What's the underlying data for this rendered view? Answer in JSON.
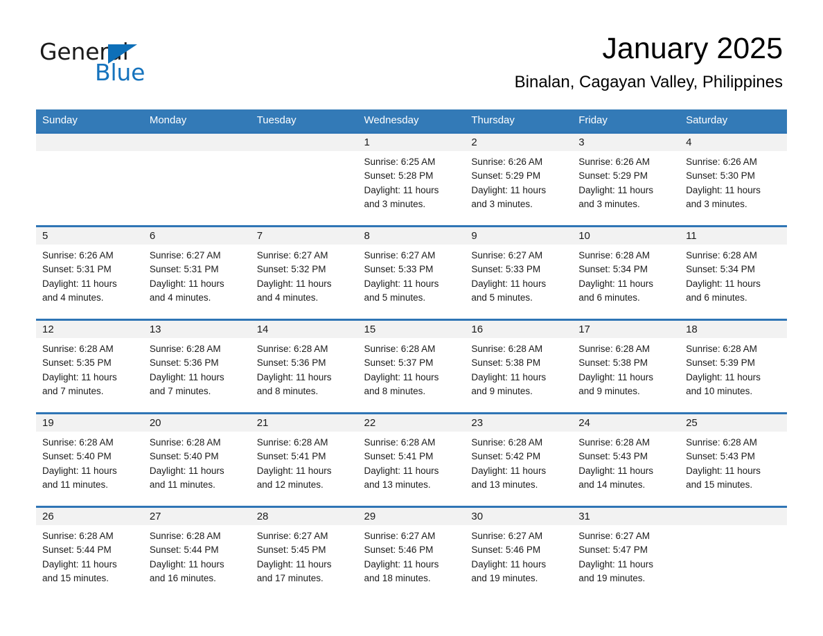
{
  "brand": {
    "name_part1": "General",
    "name_part2": "Blue",
    "triangle_color": "#0d6fb8",
    "blue_text_color": "#1673bd"
  },
  "header": {
    "title": "January 2025",
    "subtitle": "Binalan, Cagayan Valley, Philippines"
  },
  "colors": {
    "header_row_bg": "#337ab7",
    "week_border": "#2f75b5",
    "daynum_band_bg": "#f2f2f2",
    "text": "#1a1a1a"
  },
  "calendar": {
    "weekday_headers": [
      "Sunday",
      "Monday",
      "Tuesday",
      "Wednesday",
      "Thursday",
      "Friday",
      "Saturday"
    ],
    "weeks": [
      [
        {
          "day": "",
          "sunrise": "",
          "sunset": "",
          "daylight_line1": "",
          "daylight_line2": "",
          "blank": true
        },
        {
          "day": "",
          "sunrise": "",
          "sunset": "",
          "daylight_line1": "",
          "daylight_line2": "",
          "blank": true
        },
        {
          "day": "",
          "sunrise": "",
          "sunset": "",
          "daylight_line1": "",
          "daylight_line2": "",
          "blank": true
        },
        {
          "day": "1",
          "sunrise": "Sunrise: 6:25 AM",
          "sunset": "Sunset: 5:28 PM",
          "daylight_line1": "Daylight: 11 hours",
          "daylight_line2": "and 3 minutes."
        },
        {
          "day": "2",
          "sunrise": "Sunrise: 6:26 AM",
          "sunset": "Sunset: 5:29 PM",
          "daylight_line1": "Daylight: 11 hours",
          "daylight_line2": "and 3 minutes."
        },
        {
          "day": "3",
          "sunrise": "Sunrise: 6:26 AM",
          "sunset": "Sunset: 5:29 PM",
          "daylight_line1": "Daylight: 11 hours",
          "daylight_line2": "and 3 minutes."
        },
        {
          "day": "4",
          "sunrise": "Sunrise: 6:26 AM",
          "sunset": "Sunset: 5:30 PM",
          "daylight_line1": "Daylight: 11 hours",
          "daylight_line2": "and 3 minutes."
        }
      ],
      [
        {
          "day": "5",
          "sunrise": "Sunrise: 6:26 AM",
          "sunset": "Sunset: 5:31 PM",
          "daylight_line1": "Daylight: 11 hours",
          "daylight_line2": "and 4 minutes."
        },
        {
          "day": "6",
          "sunrise": "Sunrise: 6:27 AM",
          "sunset": "Sunset: 5:31 PM",
          "daylight_line1": "Daylight: 11 hours",
          "daylight_line2": "and 4 minutes."
        },
        {
          "day": "7",
          "sunrise": "Sunrise: 6:27 AM",
          "sunset": "Sunset: 5:32 PM",
          "daylight_line1": "Daylight: 11 hours",
          "daylight_line2": "and 4 minutes."
        },
        {
          "day": "8",
          "sunrise": "Sunrise: 6:27 AM",
          "sunset": "Sunset: 5:33 PM",
          "daylight_line1": "Daylight: 11 hours",
          "daylight_line2": "and 5 minutes."
        },
        {
          "day": "9",
          "sunrise": "Sunrise: 6:27 AM",
          "sunset": "Sunset: 5:33 PM",
          "daylight_line1": "Daylight: 11 hours",
          "daylight_line2": "and 5 minutes."
        },
        {
          "day": "10",
          "sunrise": "Sunrise: 6:28 AM",
          "sunset": "Sunset: 5:34 PM",
          "daylight_line1": "Daylight: 11 hours",
          "daylight_line2": "and 6 minutes."
        },
        {
          "day": "11",
          "sunrise": "Sunrise: 6:28 AM",
          "sunset": "Sunset: 5:34 PM",
          "daylight_line1": "Daylight: 11 hours",
          "daylight_line2": "and 6 minutes."
        }
      ],
      [
        {
          "day": "12",
          "sunrise": "Sunrise: 6:28 AM",
          "sunset": "Sunset: 5:35 PM",
          "daylight_line1": "Daylight: 11 hours",
          "daylight_line2": "and 7 minutes."
        },
        {
          "day": "13",
          "sunrise": "Sunrise: 6:28 AM",
          "sunset": "Sunset: 5:36 PM",
          "daylight_line1": "Daylight: 11 hours",
          "daylight_line2": "and 7 minutes."
        },
        {
          "day": "14",
          "sunrise": "Sunrise: 6:28 AM",
          "sunset": "Sunset: 5:36 PM",
          "daylight_line1": "Daylight: 11 hours",
          "daylight_line2": "and 8 minutes."
        },
        {
          "day": "15",
          "sunrise": "Sunrise: 6:28 AM",
          "sunset": "Sunset: 5:37 PM",
          "daylight_line1": "Daylight: 11 hours",
          "daylight_line2": "and 8 minutes."
        },
        {
          "day": "16",
          "sunrise": "Sunrise: 6:28 AM",
          "sunset": "Sunset: 5:38 PM",
          "daylight_line1": "Daylight: 11 hours",
          "daylight_line2": "and 9 minutes."
        },
        {
          "day": "17",
          "sunrise": "Sunrise: 6:28 AM",
          "sunset": "Sunset: 5:38 PM",
          "daylight_line1": "Daylight: 11 hours",
          "daylight_line2": "and 9 minutes."
        },
        {
          "day": "18",
          "sunrise": "Sunrise: 6:28 AM",
          "sunset": "Sunset: 5:39 PM",
          "daylight_line1": "Daylight: 11 hours",
          "daylight_line2": "and 10 minutes."
        }
      ],
      [
        {
          "day": "19",
          "sunrise": "Sunrise: 6:28 AM",
          "sunset": "Sunset: 5:40 PM",
          "daylight_line1": "Daylight: 11 hours",
          "daylight_line2": "and 11 minutes."
        },
        {
          "day": "20",
          "sunrise": "Sunrise: 6:28 AM",
          "sunset": "Sunset: 5:40 PM",
          "daylight_line1": "Daylight: 11 hours",
          "daylight_line2": "and 11 minutes."
        },
        {
          "day": "21",
          "sunrise": "Sunrise: 6:28 AM",
          "sunset": "Sunset: 5:41 PM",
          "daylight_line1": "Daylight: 11 hours",
          "daylight_line2": "and 12 minutes."
        },
        {
          "day": "22",
          "sunrise": "Sunrise: 6:28 AM",
          "sunset": "Sunset: 5:41 PM",
          "daylight_line1": "Daylight: 11 hours",
          "daylight_line2": "and 13 minutes."
        },
        {
          "day": "23",
          "sunrise": "Sunrise: 6:28 AM",
          "sunset": "Sunset: 5:42 PM",
          "daylight_line1": "Daylight: 11 hours",
          "daylight_line2": "and 13 minutes."
        },
        {
          "day": "24",
          "sunrise": "Sunrise: 6:28 AM",
          "sunset": "Sunset: 5:43 PM",
          "daylight_line1": "Daylight: 11 hours",
          "daylight_line2": "and 14 minutes."
        },
        {
          "day": "25",
          "sunrise": "Sunrise: 6:28 AM",
          "sunset": "Sunset: 5:43 PM",
          "daylight_line1": "Daylight: 11 hours",
          "daylight_line2": "and 15 minutes."
        }
      ],
      [
        {
          "day": "26",
          "sunrise": "Sunrise: 6:28 AM",
          "sunset": "Sunset: 5:44 PM",
          "daylight_line1": "Daylight: 11 hours",
          "daylight_line2": "and 15 minutes."
        },
        {
          "day": "27",
          "sunrise": "Sunrise: 6:28 AM",
          "sunset": "Sunset: 5:44 PM",
          "daylight_line1": "Daylight: 11 hours",
          "daylight_line2": "and 16 minutes."
        },
        {
          "day": "28",
          "sunrise": "Sunrise: 6:27 AM",
          "sunset": "Sunset: 5:45 PM",
          "daylight_line1": "Daylight: 11 hours",
          "daylight_line2": "and 17 minutes."
        },
        {
          "day": "29",
          "sunrise": "Sunrise: 6:27 AM",
          "sunset": "Sunset: 5:46 PM",
          "daylight_line1": "Daylight: 11 hours",
          "daylight_line2": "and 18 minutes."
        },
        {
          "day": "30",
          "sunrise": "Sunrise: 6:27 AM",
          "sunset": "Sunset: 5:46 PM",
          "daylight_line1": "Daylight: 11 hours",
          "daylight_line2": "and 19 minutes."
        },
        {
          "day": "31",
          "sunrise": "Sunrise: 6:27 AM",
          "sunset": "Sunset: 5:47 PM",
          "daylight_line1": "Daylight: 11 hours",
          "daylight_line2": "and 19 minutes."
        },
        {
          "day": "",
          "sunrise": "",
          "sunset": "",
          "daylight_line1": "",
          "daylight_line2": "",
          "blank": true
        }
      ]
    ]
  }
}
